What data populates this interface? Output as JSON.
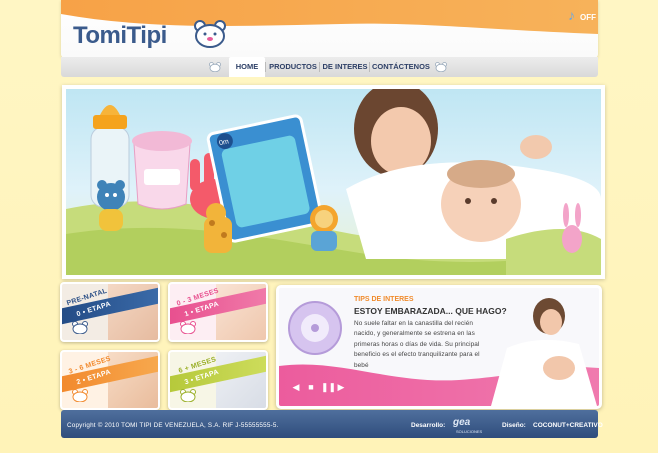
{
  "brand": {
    "name": "TomiTipi"
  },
  "sound": {
    "label": "OFF"
  },
  "nav": {
    "items": [
      {
        "label": "HOME",
        "active": true
      },
      {
        "label": "PRODUCTOS"
      },
      {
        "label": "DE INTERES"
      },
      {
        "label": "CONTÁCTENOS"
      }
    ]
  },
  "banner": {
    "product_badge": "0m"
  },
  "stages": [
    {
      "top": "PRE-NATAL",
      "bottom": "0 • ETAPA"
    },
    {
      "top": "0 - 3 MESES",
      "bottom": "1 • ETAPA"
    },
    {
      "top": "3 - 6 MESES",
      "bottom": "2 • ETAPA"
    },
    {
      "top": "6 + MESES",
      "bottom": "3 • ETAPA"
    }
  ],
  "tips": {
    "title": "TIPS DE INTERES",
    "heading": "ESTOY EMBARAZADA... QUE HAGO?",
    "body": "No suele faltar en la canastilla del recién nacido, y generalmente se estrena en las primeras horas o días de vida. Su principal beneficio es el efecto tranquilizante para el bebé"
  },
  "footer": {
    "copyright": "Copyright © 2010 TOMI TIPI DE VENEZUELA, S.A. RIF J-55555555-5.",
    "dev_label": "Desarrollo:",
    "dev_logo": "gea",
    "dev_sub": "SOLUCIONES",
    "design_label": "Diseño:",
    "design_logo": "COCONUT+CREATIVO"
  },
  "colors": {
    "accent_orange": "#f08b2c",
    "navy": "#2d3f66",
    "pink": "#e85c9a"
  }
}
